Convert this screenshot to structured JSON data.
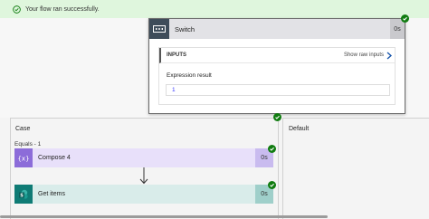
{
  "banner": {
    "message": "Your flow ran successfully."
  },
  "switch": {
    "title": "Switch",
    "duration": "0s",
    "inputs_label": "INPUTS",
    "show_raw_inputs": "Show raw inputs",
    "expression_result_label": "Expression result",
    "expression_result_value": "1"
  },
  "case": {
    "label": "Case",
    "equals": "Equals - 1"
  },
  "default": {
    "label": "Default"
  },
  "actions": [
    {
      "label": "Compose 4",
      "duration": "0s",
      "icon": "compose-icon"
    },
    {
      "label": "Get items",
      "duration": "0s",
      "icon": "sharepoint-icon"
    }
  ],
  "colors": {
    "success_green": "#107c10",
    "banner_bg": "#dff6dd",
    "compose_accent": "#8c6cd9",
    "sharepoint_accent": "#0f7b75",
    "switch_header": "#3e4c5a"
  }
}
